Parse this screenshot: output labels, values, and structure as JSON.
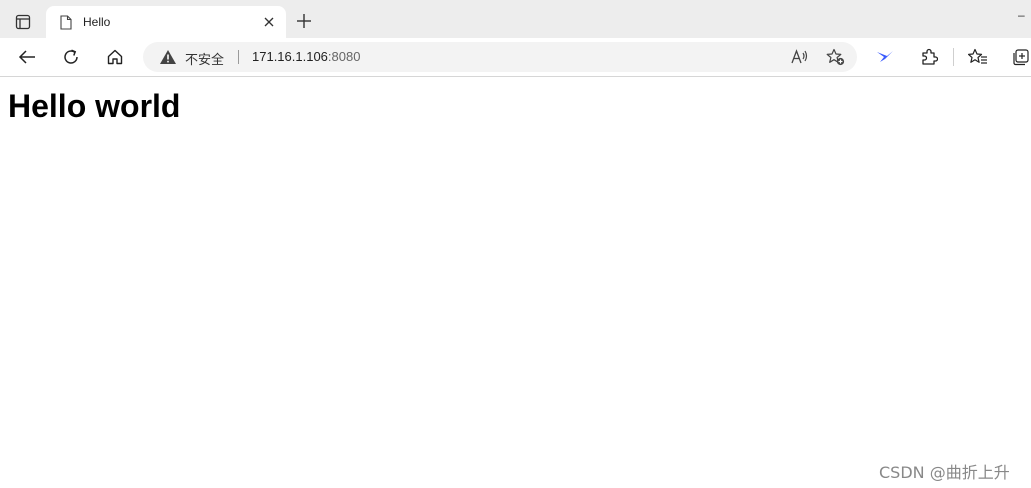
{
  "tab": {
    "title": "Hello",
    "minimize_glyph": "–"
  },
  "address_bar": {
    "security_label": "不安全",
    "url_host": "171.16.1.106",
    "url_port": ":8080"
  },
  "page": {
    "heading": "Hello world"
  },
  "watermark": "CSDN @曲折上升",
  "icons": {
    "tab_actions": "tab-actions-icon",
    "favicon": "document-icon",
    "close": "close-icon",
    "new_tab": "plus-icon",
    "back": "back-arrow-icon",
    "reload": "reload-icon",
    "home": "home-icon",
    "warning": "warning-icon",
    "read_aloud": "read-aloud-icon",
    "add_favorite": "add-favorite-icon",
    "extension_bird": "bird-extension-icon",
    "extensions": "puzzle-icon",
    "favorites": "favorites-icon",
    "collections": "collections-icon"
  },
  "colors": {
    "tabbar": "#ededed",
    "accent_extension": "#3b5bfd"
  }
}
